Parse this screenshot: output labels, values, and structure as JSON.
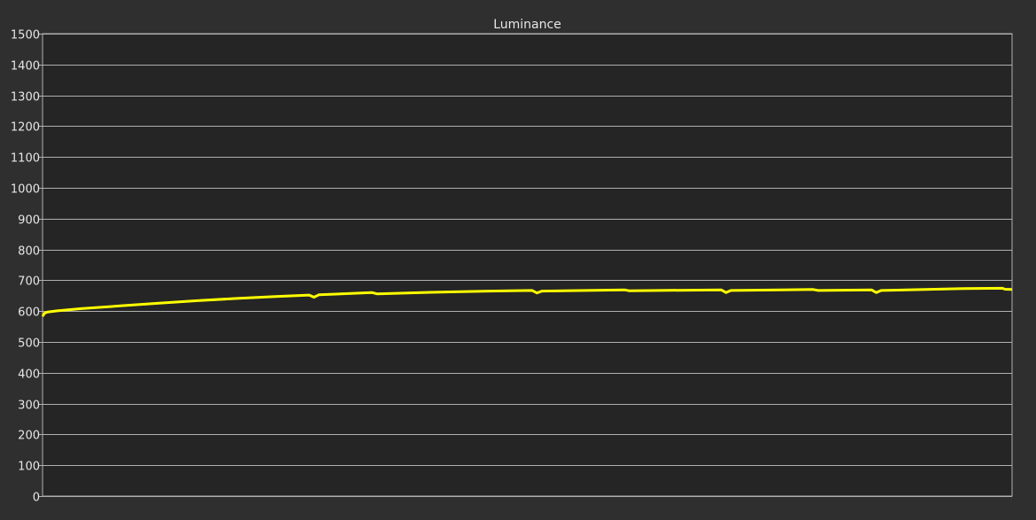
{
  "chart_data": {
    "type": "line",
    "title": "Luminance",
    "xlabel": "",
    "ylabel": "",
    "ylim": [
      0,
      1500
    ],
    "yticks": [
      0,
      100,
      200,
      300,
      400,
      500,
      600,
      700,
      800,
      900,
      1000,
      1100,
      1200,
      1300,
      1400,
      1500
    ],
    "xlim": [
      0,
      1000
    ],
    "grid": true,
    "colors": {
      "background": "#2f2f2f",
      "plot": "#252525",
      "grid": "#b0b0b0",
      "series": "#ffff00",
      "text": "#e6e6e6"
    },
    "series": [
      {
        "values": [
          {
            "x": 0,
            "y": 583
          },
          {
            "x": 2,
            "y": 593
          },
          {
            "x": 5,
            "y": 597
          },
          {
            "x": 15,
            "y": 601
          },
          {
            "x": 40,
            "y": 608
          },
          {
            "x": 80,
            "y": 617
          },
          {
            "x": 120,
            "y": 626
          },
          {
            "x": 160,
            "y": 634
          },
          {
            "x": 200,
            "y": 641
          },
          {
            "x": 240,
            "y": 647
          },
          {
            "x": 275,
            "y": 652
          },
          {
            "x": 280,
            "y": 645
          },
          {
            "x": 285,
            "y": 653
          },
          {
            "x": 340,
            "y": 660
          },
          {
            "x": 345,
            "y": 656
          },
          {
            "x": 400,
            "y": 661
          },
          {
            "x": 460,
            "y": 665
          },
          {
            "x": 505,
            "y": 667
          },
          {
            "x": 510,
            "y": 659
          },
          {
            "x": 515,
            "y": 665
          },
          {
            "x": 600,
            "y": 669
          },
          {
            "x": 605,
            "y": 666
          },
          {
            "x": 700,
            "y": 669
          },
          {
            "x": 705,
            "y": 660
          },
          {
            "x": 710,
            "y": 667
          },
          {
            "x": 795,
            "y": 670
          },
          {
            "x": 800,
            "y": 667
          },
          {
            "x": 855,
            "y": 669
          },
          {
            "x": 860,
            "y": 660
          },
          {
            "x": 865,
            "y": 667
          },
          {
            "x": 950,
            "y": 673
          },
          {
            "x": 990,
            "y": 674
          },
          {
            "x": 993,
            "y": 671
          },
          {
            "x": 1000,
            "y": 670
          }
        ]
      }
    ]
  }
}
